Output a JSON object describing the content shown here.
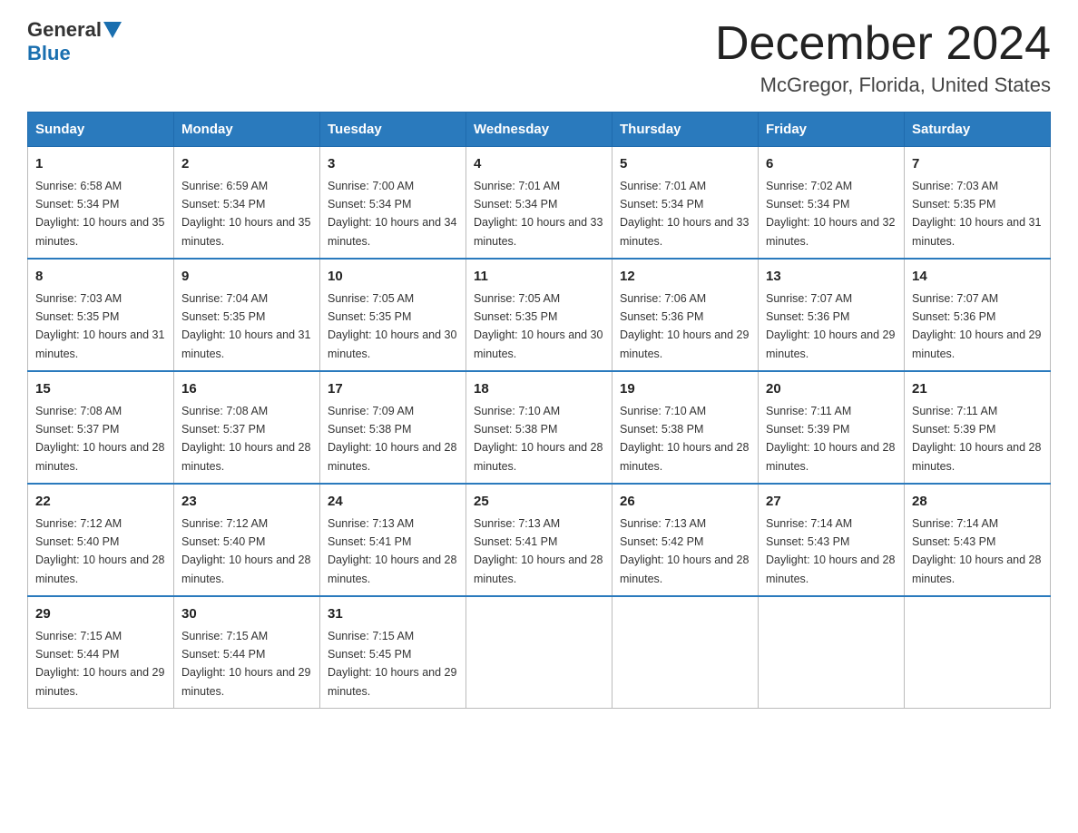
{
  "header": {
    "logo": {
      "part1": "General",
      "part2": "Blue"
    },
    "title": "December 2024",
    "location": "McGregor, Florida, United States"
  },
  "days_of_week": [
    "Sunday",
    "Monday",
    "Tuesday",
    "Wednesday",
    "Thursday",
    "Friday",
    "Saturday"
  ],
  "weeks": [
    [
      {
        "day": "1",
        "sunrise": "6:58 AM",
        "sunset": "5:34 PM",
        "daylight": "10 hours and 35 minutes."
      },
      {
        "day": "2",
        "sunrise": "6:59 AM",
        "sunset": "5:34 PM",
        "daylight": "10 hours and 35 minutes."
      },
      {
        "day": "3",
        "sunrise": "7:00 AM",
        "sunset": "5:34 PM",
        "daylight": "10 hours and 34 minutes."
      },
      {
        "day": "4",
        "sunrise": "7:01 AM",
        "sunset": "5:34 PM",
        "daylight": "10 hours and 33 minutes."
      },
      {
        "day": "5",
        "sunrise": "7:01 AM",
        "sunset": "5:34 PM",
        "daylight": "10 hours and 33 minutes."
      },
      {
        "day": "6",
        "sunrise": "7:02 AM",
        "sunset": "5:34 PM",
        "daylight": "10 hours and 32 minutes."
      },
      {
        "day": "7",
        "sunrise": "7:03 AM",
        "sunset": "5:35 PM",
        "daylight": "10 hours and 31 minutes."
      }
    ],
    [
      {
        "day": "8",
        "sunrise": "7:03 AM",
        "sunset": "5:35 PM",
        "daylight": "10 hours and 31 minutes."
      },
      {
        "day": "9",
        "sunrise": "7:04 AM",
        "sunset": "5:35 PM",
        "daylight": "10 hours and 31 minutes."
      },
      {
        "day": "10",
        "sunrise": "7:05 AM",
        "sunset": "5:35 PM",
        "daylight": "10 hours and 30 minutes."
      },
      {
        "day": "11",
        "sunrise": "7:05 AM",
        "sunset": "5:35 PM",
        "daylight": "10 hours and 30 minutes."
      },
      {
        "day": "12",
        "sunrise": "7:06 AM",
        "sunset": "5:36 PM",
        "daylight": "10 hours and 29 minutes."
      },
      {
        "day": "13",
        "sunrise": "7:07 AM",
        "sunset": "5:36 PM",
        "daylight": "10 hours and 29 minutes."
      },
      {
        "day": "14",
        "sunrise": "7:07 AM",
        "sunset": "5:36 PM",
        "daylight": "10 hours and 29 minutes."
      }
    ],
    [
      {
        "day": "15",
        "sunrise": "7:08 AM",
        "sunset": "5:37 PM",
        "daylight": "10 hours and 28 minutes."
      },
      {
        "day": "16",
        "sunrise": "7:08 AM",
        "sunset": "5:37 PM",
        "daylight": "10 hours and 28 minutes."
      },
      {
        "day": "17",
        "sunrise": "7:09 AM",
        "sunset": "5:38 PM",
        "daylight": "10 hours and 28 minutes."
      },
      {
        "day": "18",
        "sunrise": "7:10 AM",
        "sunset": "5:38 PM",
        "daylight": "10 hours and 28 minutes."
      },
      {
        "day": "19",
        "sunrise": "7:10 AM",
        "sunset": "5:38 PM",
        "daylight": "10 hours and 28 minutes."
      },
      {
        "day": "20",
        "sunrise": "7:11 AM",
        "sunset": "5:39 PM",
        "daylight": "10 hours and 28 minutes."
      },
      {
        "day": "21",
        "sunrise": "7:11 AM",
        "sunset": "5:39 PM",
        "daylight": "10 hours and 28 minutes."
      }
    ],
    [
      {
        "day": "22",
        "sunrise": "7:12 AM",
        "sunset": "5:40 PM",
        "daylight": "10 hours and 28 minutes."
      },
      {
        "day": "23",
        "sunrise": "7:12 AM",
        "sunset": "5:40 PM",
        "daylight": "10 hours and 28 minutes."
      },
      {
        "day": "24",
        "sunrise": "7:13 AM",
        "sunset": "5:41 PM",
        "daylight": "10 hours and 28 minutes."
      },
      {
        "day": "25",
        "sunrise": "7:13 AM",
        "sunset": "5:41 PM",
        "daylight": "10 hours and 28 minutes."
      },
      {
        "day": "26",
        "sunrise": "7:13 AM",
        "sunset": "5:42 PM",
        "daylight": "10 hours and 28 minutes."
      },
      {
        "day": "27",
        "sunrise": "7:14 AM",
        "sunset": "5:43 PM",
        "daylight": "10 hours and 28 minutes."
      },
      {
        "day": "28",
        "sunrise": "7:14 AM",
        "sunset": "5:43 PM",
        "daylight": "10 hours and 28 minutes."
      }
    ],
    [
      {
        "day": "29",
        "sunrise": "7:15 AM",
        "sunset": "5:44 PM",
        "daylight": "10 hours and 29 minutes."
      },
      {
        "day": "30",
        "sunrise": "7:15 AM",
        "sunset": "5:44 PM",
        "daylight": "10 hours and 29 minutes."
      },
      {
        "day": "31",
        "sunrise": "7:15 AM",
        "sunset": "5:45 PM",
        "daylight": "10 hours and 29 minutes."
      },
      null,
      null,
      null,
      null
    ]
  ]
}
